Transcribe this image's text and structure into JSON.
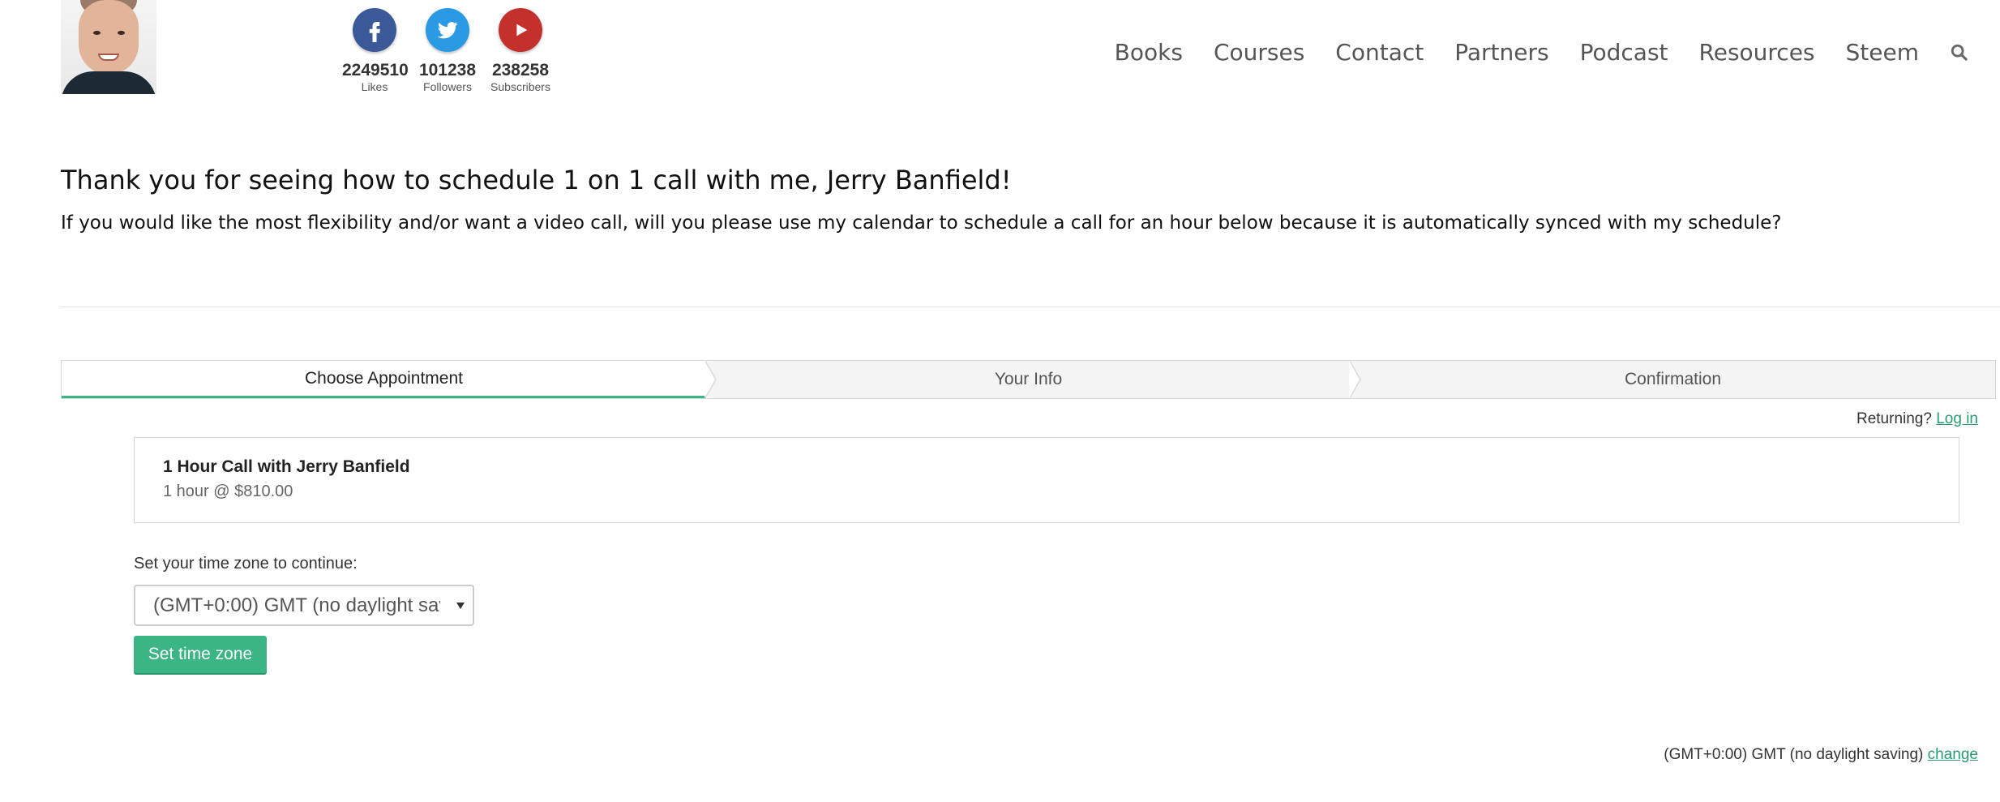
{
  "header": {
    "social": [
      {
        "name": "facebook",
        "icon": "facebook-icon",
        "count": "2249510",
        "label": "Likes",
        "color": "#3b5998"
      },
      {
        "name": "twitter",
        "icon": "twitter-icon",
        "count": "101238",
        "label": "Followers",
        "color": "#2b9ae4"
      },
      {
        "name": "youtube",
        "icon": "youtube-icon",
        "count": "238258",
        "label": "Subscribers",
        "color": "#c4302b"
      }
    ],
    "nav": [
      "Books",
      "Courses",
      "Contact",
      "Partners",
      "Podcast",
      "Resources",
      "Steem"
    ],
    "search_icon": "search-icon"
  },
  "content": {
    "heading": "Thank you for seeing how to schedule 1 on 1 call with me, Jerry Banfield!",
    "intro": "If you would like the most flexibility and/or want a video call, will you please use my calendar to schedule a call for an hour below because it is automatically synced with my schedule?"
  },
  "scheduler": {
    "steps": [
      "Choose Appointment",
      "Your Info",
      "Confirmation"
    ],
    "active_step": "Choose Appointment",
    "accent_color": "#3bb584",
    "returning_text": "Returning?",
    "login_link": "Log in",
    "appointment": {
      "title": "1 Hour Call with Jerry Banfield",
      "detail": "1 hour @ $810.00"
    },
    "timezone_label": "Set your time zone to continue:",
    "timezone_value": "(GMT+0:00) GMT (no daylight saving)",
    "timezone_button": "Set time zone",
    "footer_timezone": "(GMT+0:00) GMT (no daylight saving)",
    "footer_change": "change"
  }
}
